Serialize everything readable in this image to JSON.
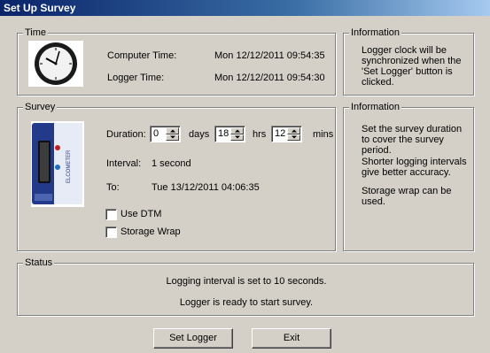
{
  "window": {
    "title": "Set Up Survey"
  },
  "time_group": {
    "label": "Time",
    "computer_time_label": "Computer Time:",
    "computer_time_value": "Mon 12/12/2011 09:54:35",
    "logger_time_label": "Logger Time:",
    "logger_time_value": "Mon 12/12/2011 09:54:30"
  },
  "time_info": {
    "label": "Information",
    "text": "Logger clock will be synchronized when the 'Set Logger' button is clicked."
  },
  "survey_group": {
    "label": "Survey",
    "duration_label": "Duration:",
    "days_value": "0",
    "days_unit": "days",
    "hrs_value": "18",
    "hrs_unit": "hrs",
    "mins_value": "12",
    "mins_unit": "mins",
    "interval_label": "Interval:",
    "interval_value": "1 second",
    "to_label": "To:",
    "to_value": "Tue 13/12/2011 04:06:35",
    "use_dtm_label": "Use DTM",
    "storage_wrap_label": "Storage Wrap",
    "device_text": "ELCOMETER"
  },
  "survey_info": {
    "label": "Information",
    "para1": "Set the survey duration to cover the survey period.",
    "para2": "Shorter logging intervals give better accuracy.",
    "para3": "Storage wrap can be used."
  },
  "status_group": {
    "label": "Status",
    "line1": "Logging interval is set to 10 seconds.",
    "line2": "Logger is ready to start survey."
  },
  "buttons": {
    "set_logger": "Set Logger",
    "exit": "Exit"
  }
}
